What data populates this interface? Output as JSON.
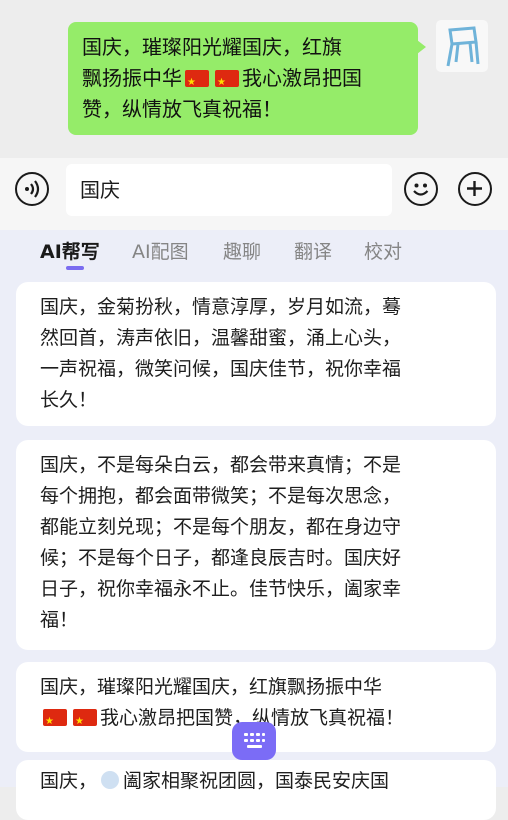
{
  "chat": {
    "message": {
      "line1": "国庆，璀璨阳光耀国庆，红旗",
      "line2a": "飘扬振中华",
      "line2b": "我心激昂把国",
      "line3": "赞，纵情放飞真祝福！"
    }
  },
  "input_bar": {
    "text": "国庆",
    "icons": [
      "voice-icon",
      "emoji-icon",
      "plus-icon"
    ]
  },
  "tabs": [
    {
      "label": "AI帮写",
      "active": true
    },
    {
      "label": "AI配图",
      "active": false
    },
    {
      "label": "趣聊",
      "active": false
    },
    {
      "label": "翻译",
      "active": false
    },
    {
      "label": "校对",
      "active": false
    }
  ],
  "suggestions": [
    {
      "lines": [
        "国庆，金菊扮秋，情意淳厚，岁月如流，蓦",
        "然回首，涛声依旧，温馨甜蜜，涌上心头，",
        "一声祝福，微笑问候，国庆佳节，祝你幸福",
        "长久！"
      ]
    },
    {
      "lines": [
        "国庆，不是每朵白云，都会带来真情；不是",
        "每个拥抱，都会面带微笑；不是每次思念，",
        "都能立刻兑现；不是每个朋友，都在身边守",
        "候；不是每个日子，都逢良辰吉时。国庆好",
        "日子，祝你幸福永不止。佳节快乐，阖家幸",
        "福！"
      ]
    },
    {
      "lines": [
        "国庆，璀璨阳光耀国庆，红旗飘扬振中华",
        "我心激昂把国赞，纵情放飞真祝福！"
      ]
    },
    {
      "lines": [
        "国庆，",
        "阖家相聚祝团圆，国泰民安庆国"
      ]
    }
  ],
  "colors": {
    "bubble": "#95ec69",
    "accent": "#7b6cf6",
    "flag": "#de2910"
  }
}
